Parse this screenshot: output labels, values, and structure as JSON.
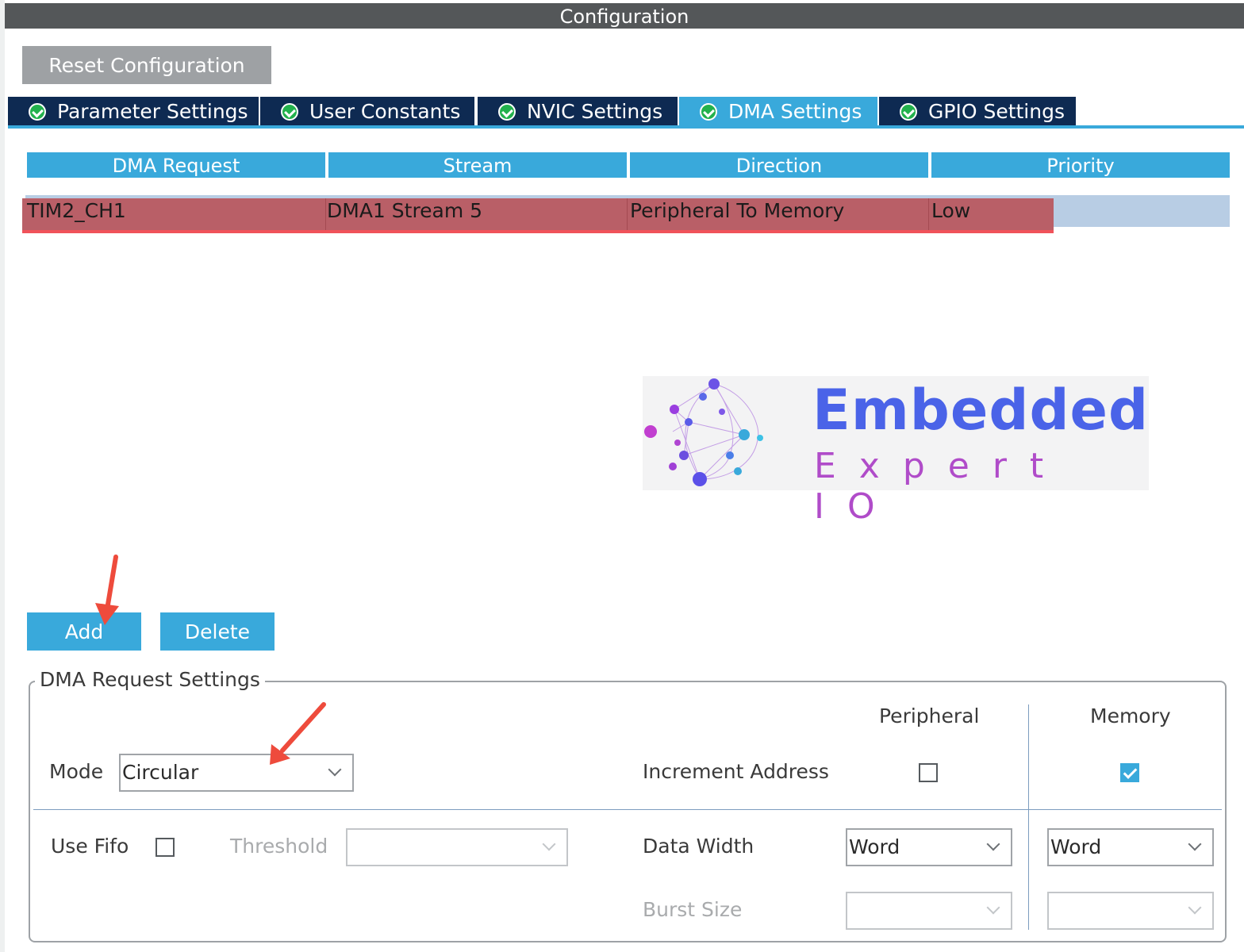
{
  "window": {
    "title": "Configuration"
  },
  "toolbar": {
    "reset_label": "Reset Configuration"
  },
  "tabs": [
    {
      "label": "Parameter Settings",
      "active": false
    },
    {
      "label": "User Constants",
      "active": false
    },
    {
      "label": "NVIC Settings",
      "active": false
    },
    {
      "label": "DMA Settings",
      "active": true
    },
    {
      "label": "GPIO Settings",
      "active": false
    }
  ],
  "table": {
    "headers": [
      "DMA Request",
      "Stream",
      "Direction",
      "Priority"
    ],
    "rows": [
      {
        "request": "TIM2_CH1",
        "stream": "DMA1 Stream 5",
        "direction": "Peripheral To Memory",
        "priority": "Low",
        "selected": true
      }
    ]
  },
  "logo": {
    "line1": "Embedded",
    "line2": "Expert IO"
  },
  "actions": {
    "add_label": "Add",
    "delete_label": "Delete"
  },
  "settings": {
    "title": "DMA Request Settings",
    "mode_label": "Mode",
    "mode_value": "Circular",
    "peripheral_header": "Peripheral",
    "memory_header": "Memory",
    "increment_label": "Increment Address",
    "increment_peripheral": false,
    "increment_memory": true,
    "use_fifo_label": "Use Fifo",
    "use_fifo": false,
    "threshold_label": "Threshold",
    "threshold_value": "",
    "data_width_label": "Data Width",
    "data_width_peripheral": "Word",
    "data_width_memory": "Word",
    "burst_size_label": "Burst Size",
    "burst_peripheral": "",
    "burst_memory": ""
  },
  "colors": {
    "accent": "#39a9db",
    "tab_dark": "#0e2a52",
    "titlebar": "#545759",
    "highlight": "#b95f67",
    "annotation_arrow": "#ee4b3c"
  }
}
